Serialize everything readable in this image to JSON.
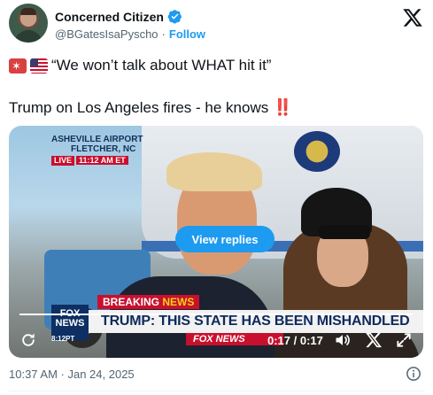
{
  "author": {
    "display_name": "Concerned Citizen",
    "handle": "@BGatesIsaPyscho",
    "separator": "·",
    "follow_label": "Follow",
    "verified_color": "#1d9bf0"
  },
  "tweet": {
    "emojis": [
      "rotating-light",
      "us-flag"
    ],
    "line1": "“We won’t talk about WHAT hit it”",
    "line2": "Trump on Los Angeles fires - he knows",
    "line2_emoji": "‼️"
  },
  "video": {
    "location_line1": "Asheville Airport",
    "location_line2": "Fletcher, NC",
    "live_label": "LIVE",
    "live_time": "11:12 AM ET",
    "breaking_label": "BREAKING",
    "breaking_news": "NEWS",
    "headline": "TRUMP: THIS STATE HAS BEEN MISHANDLED",
    "fox_logo_line1": "FOX",
    "fox_logo_line2": "NEWS",
    "fox_logo_time": "8:12PT",
    "ticker": "FOX NEWS",
    "view_replies_label": "View replies",
    "time_readout": "0:17 / 0:17",
    "progress": 1.0,
    "accent_color": "#1d9bf0"
  },
  "footer": {
    "timestamp": "10:37 AM · Jan 24, 2025"
  }
}
